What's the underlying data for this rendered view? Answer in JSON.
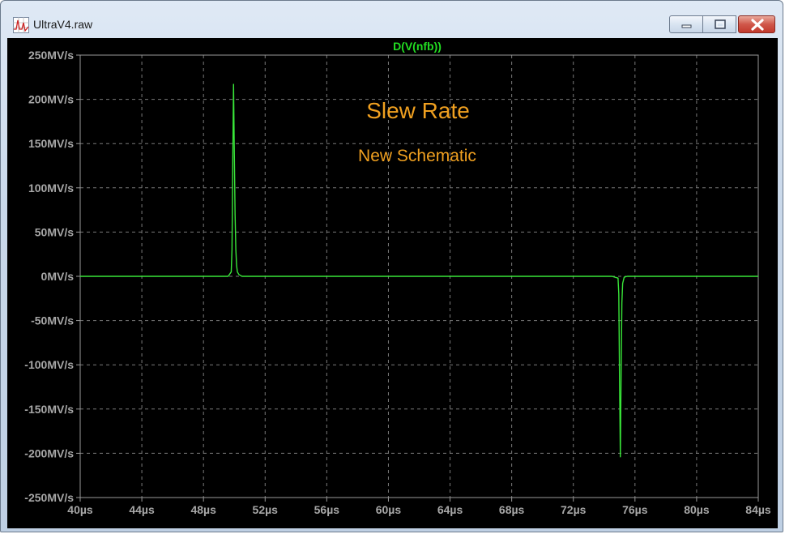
{
  "window": {
    "title": "UltraV4.raw",
    "app_icon": "waveform-viewer-icon",
    "controls": {
      "minimize_icon": "minimize-icon",
      "maximize_icon": "maximize-icon",
      "close_icon": "close-icon"
    }
  },
  "plot": {
    "trace_label": "D(V(nfb))",
    "annotation_title": "Slew Rate",
    "annotation_subtitle": "New Schematic",
    "colors": {
      "background": "#000000",
      "trace": "#39e639",
      "trace_label": "#22dd22",
      "annotation": "#f0a020",
      "axis_text": "#a7a7a7",
      "grid": "#7a7a7a"
    }
  },
  "chart_data": {
    "type": "line",
    "title": "D(V(nfb))",
    "xlabel": "",
    "ylabel": "",
    "xlim": [
      40,
      84
    ],
    "ylim": [
      -250,
      250
    ],
    "x_unit": "µs",
    "y_unit": "MV/s",
    "x_ticks": [
      "40µs",
      "44µs",
      "48µs",
      "52µs",
      "56µs",
      "60µs",
      "64µs",
      "68µs",
      "72µs",
      "76µs",
      "80µs",
      "84µs"
    ],
    "x_tick_values": [
      40,
      44,
      48,
      52,
      56,
      60,
      64,
      68,
      72,
      76,
      80,
      84
    ],
    "y_ticks": [
      "250MV/s",
      "200MV/s",
      "150MV/s",
      "100MV/s",
      "50MV/s",
      "0MV/s",
      "-50MV/s",
      "-100MV/s",
      "-150MV/s",
      "-200MV/s",
      "-250MV/s"
    ],
    "y_tick_values": [
      250,
      200,
      150,
      100,
      50,
      0,
      -50,
      -100,
      -150,
      -200,
      -250
    ],
    "grid": true,
    "series": [
      {
        "name": "D(V(nfb))",
        "color": "#39e639",
        "x": [
          40,
          49.6,
          49.8,
          49.85,
          49.9,
          49.95,
          50.0,
          50.05,
          50.1,
          50.15,
          50.2,
          50.3,
          50.5,
          51,
          65,
          74.5,
          74.9,
          74.95,
          75.0,
          75.05,
          75.1,
          75.15,
          75.2,
          75.3,
          75.5,
          84
        ],
        "y": [
          0,
          0,
          5,
          30,
          130,
          217,
          140,
          70,
          30,
          12,
          5,
          2,
          0,
          0,
          0,
          0,
          -2,
          -20,
          -120,
          -204,
          -110,
          -30,
          -8,
          -1,
          0,
          0
        ]
      }
    ]
  }
}
